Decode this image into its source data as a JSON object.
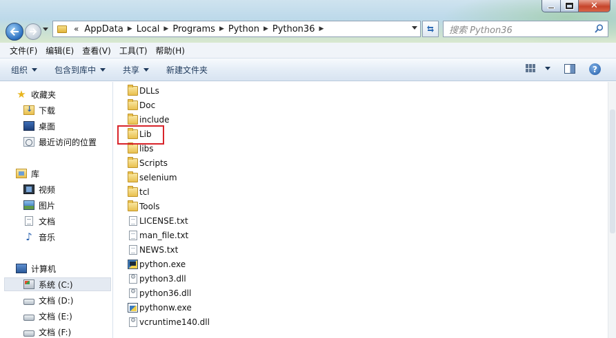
{
  "window": {
    "close_glyph": "✕"
  },
  "address": {
    "overflow_glyph": "«",
    "crumbs": [
      "AppData",
      "Local",
      "Programs",
      "Python",
      "Python36"
    ]
  },
  "search": {
    "placeholder": "搜索 Python36"
  },
  "menu": [
    "文件(F)",
    "编辑(E)",
    "查看(V)",
    "工具(T)",
    "帮助(H)"
  ],
  "toolbar": {
    "organize": "组织",
    "include_in_library": "包含到库中",
    "share": "共享",
    "new_folder": "新建文件夹",
    "help_glyph": "?"
  },
  "nav": {
    "favorites": "收藏夹",
    "downloads": "下载",
    "desktop": "桌面",
    "recent": "最近访问的位置",
    "libraries": "库",
    "videos": "视频",
    "pictures": "图片",
    "documents": "文档",
    "music": "音乐",
    "computer": "计算机",
    "drive_c": "系统 (C:)",
    "drive_d": "文档 (D:)",
    "drive_e": "文档 (E:)",
    "drive_f": "文档 (F:)"
  },
  "files": [
    {
      "name": "DLLs",
      "icon": "folder-icon"
    },
    {
      "name": "Doc",
      "icon": "folder-icon"
    },
    {
      "name": "include",
      "icon": "folder-icon"
    },
    {
      "name": "Lib",
      "icon": "folder-icon"
    },
    {
      "name": "libs",
      "icon": "folder-icon"
    },
    {
      "name": "Scripts",
      "icon": "folder-icon"
    },
    {
      "name": "selenium",
      "icon": "folder-icon"
    },
    {
      "name": "tcl",
      "icon": "folder-icon"
    },
    {
      "name": "Tools",
      "icon": "folder-icon"
    },
    {
      "name": "LICENSE.txt",
      "icon": "text-file-icon"
    },
    {
      "name": "man_file.txt",
      "icon": "text-file-icon"
    },
    {
      "name": "NEWS.txt",
      "icon": "text-file-icon"
    },
    {
      "name": "python.exe",
      "icon": "python-exe-icon"
    },
    {
      "name": "python3.dll",
      "icon": "dll-file-icon"
    },
    {
      "name": "python36.dll",
      "icon": "dll-file-icon"
    },
    {
      "name": "pythonw.exe",
      "icon": "pythonw-exe-icon"
    },
    {
      "name": "vcruntime140.dll",
      "icon": "dll-file-icon"
    }
  ],
  "highlight_color": "#d8232a"
}
